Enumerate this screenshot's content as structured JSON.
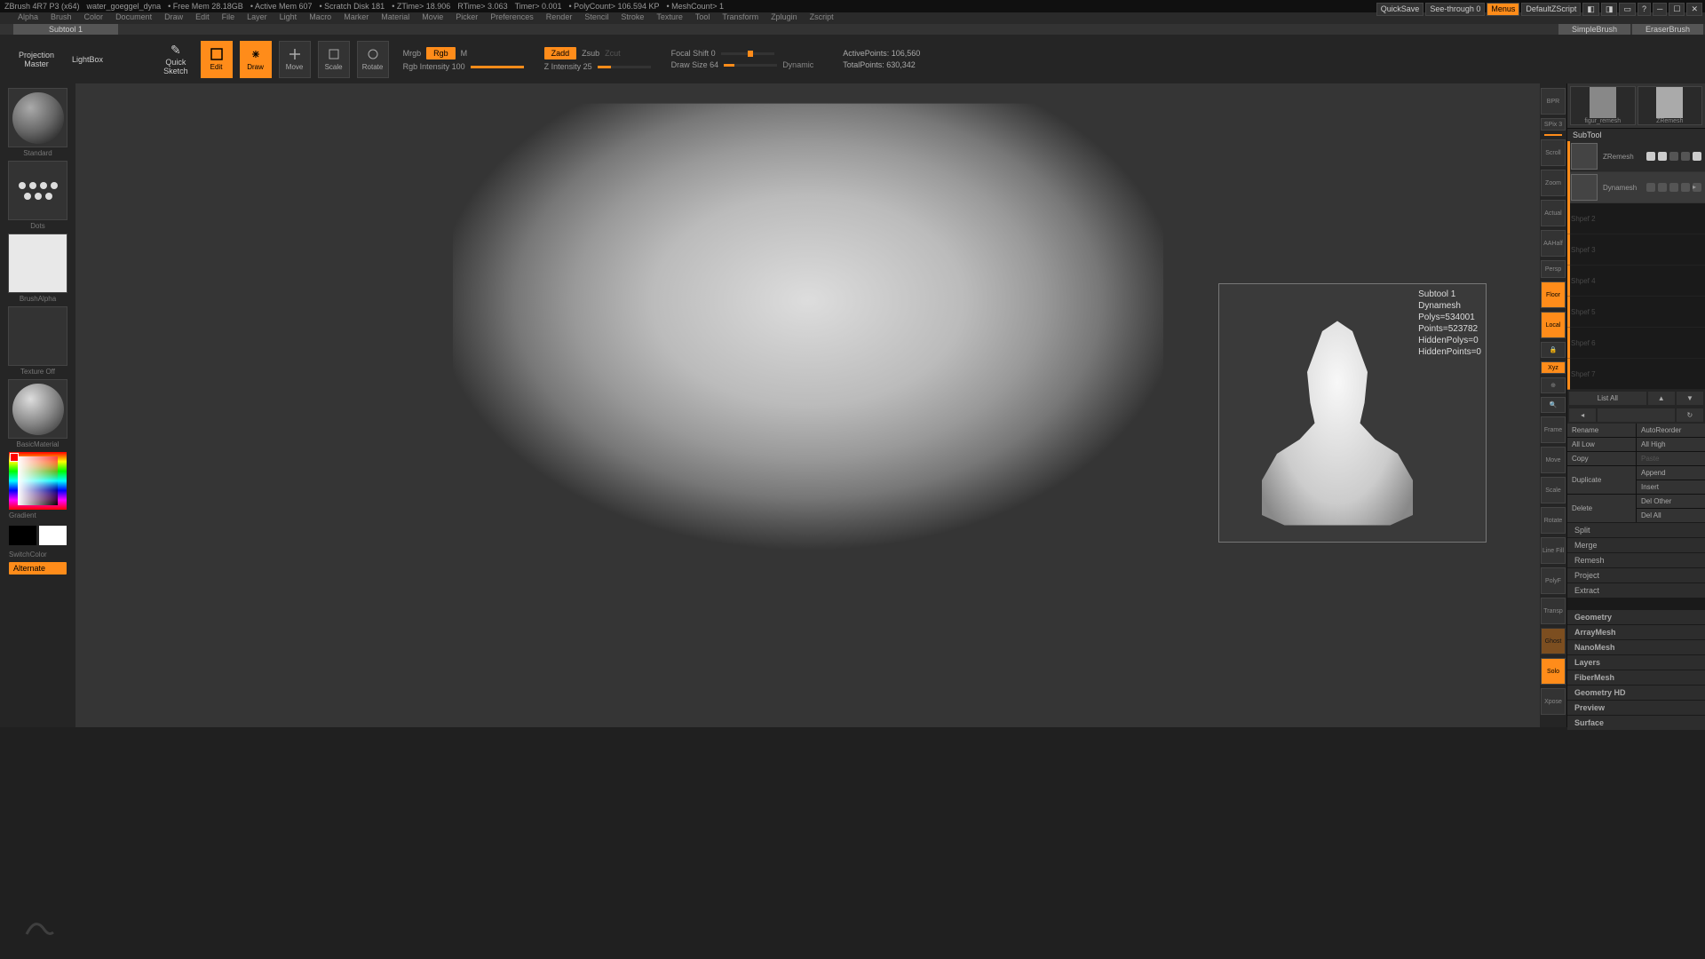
{
  "titlebar": {
    "app": "ZBrush 4R7 P3 (x64)",
    "file": "water_goeggel_dyna",
    "mem": "• Free Mem 28.18GB",
    "active": "• Active Mem 607",
    "scratch": "• Scratch Disk 181",
    "ztime": "• ZTime> 18.906",
    "rtime": "RTime> 3.063",
    "timer": "Timer> 0.001",
    "poly": "• PolyCount> 106.594 KP",
    "mesh": "• MeshCount> 1"
  },
  "topbuttons": {
    "quicksave": "QuickSave",
    "seethrough": "See-through   0",
    "menus": "Menus",
    "script": "DefaultZScript"
  },
  "menubar": [
    "Alpha",
    "Brush",
    "Color",
    "Document",
    "Draw",
    "Edit",
    "File",
    "Layer",
    "Light",
    "Macro",
    "Marker",
    "Material",
    "Movie",
    "Picker",
    "Preferences",
    "Render",
    "Stencil",
    "Stroke",
    "Texture",
    "Tool",
    "Transform",
    "Zplugin",
    "Zscript"
  ],
  "tabs": {
    "tab1": "Subtool 1",
    "simple": "SimpleBrush",
    "eraser": "EraserBrush"
  },
  "toolbar": {
    "projection": "Projection\nMaster",
    "lightbox": "LightBox",
    "quicksketch": "Quick\nSketch",
    "edit": "Edit",
    "draw": "Draw",
    "move": "Move",
    "scale": "Scale",
    "rotate": "Rotate",
    "mrgb": "Mrgb",
    "rgb": "Rgb",
    "m": "M",
    "rgbint": "Rgb Intensity 100",
    "zadd": "Zadd",
    "zsub": "Zsub",
    "zcut": "Zcut",
    "zint": "Z Intensity 25",
    "focal": "Focal Shift 0",
    "drawsize": "Draw Size 64",
    "dynamic": "Dynamic",
    "activepts": "ActivePoints: 106,560",
    "totalpts": "TotalPoints: 630,342"
  },
  "left": {
    "brush": "Standard",
    "stroke": "Dots",
    "alpha": "BrushAlpha",
    "texture": "Texture Off",
    "material": "BasicMaterial",
    "gradient": "Gradient",
    "switch": "SwitchColor",
    "alternate": "Alternate"
  },
  "rightdock": [
    "BPR",
    "SPix 3",
    "Scroll",
    "Zoom",
    "Actual",
    "AAHalf",
    "Persp",
    "Floor",
    "Local",
    "Xyz",
    "",
    "Frame",
    "Move",
    "Scale",
    "Rotate",
    "Line Fill",
    "PolyF",
    "Transp",
    "Ghost",
    "Solo",
    "Xpose"
  ],
  "toolprev": {
    "a": "figur_remesh",
    "b": "ZRemesh"
  },
  "section": "SubTool",
  "subtools": [
    {
      "name": "ZRemesh"
    },
    {
      "name": "Dynamesh"
    },
    {
      "name": "Shpef 2"
    },
    {
      "name": "Shpef 3"
    },
    {
      "name": "Shpef 4"
    },
    {
      "name": "Shpef 5"
    },
    {
      "name": "Shpef 6"
    },
    {
      "name": "Shpef 7"
    }
  ],
  "listctl": {
    "list": "List All",
    "up": "▲",
    "dn": "▼"
  },
  "btns": {
    "rename": "Rename",
    "autoreorder": "AutoReorder",
    "alllow": "All Low",
    "allhigh": "All High",
    "copy": "Copy",
    "paste": "Paste",
    "duplicate": "Duplicate",
    "append": "Append",
    "insert": "Insert",
    "delete": "Delete",
    "delother": "Del Other",
    "delall": "Del All"
  },
  "acc": [
    "Split",
    "Merge",
    "Remesh",
    "Project",
    "Extract",
    "Geometry",
    "ArrayMesh",
    "NanoMesh",
    "Layers",
    "FiberMesh",
    "Geometry HD",
    "Preview",
    "Surface"
  ],
  "popup": {
    "title": "Subtool 1",
    "name": "Dynamesh",
    "polys": "Polys=534001",
    "points": "Points=523782",
    "hpolys": "HiddenPolys=0",
    "hpoints": "HiddenPoints=0"
  }
}
